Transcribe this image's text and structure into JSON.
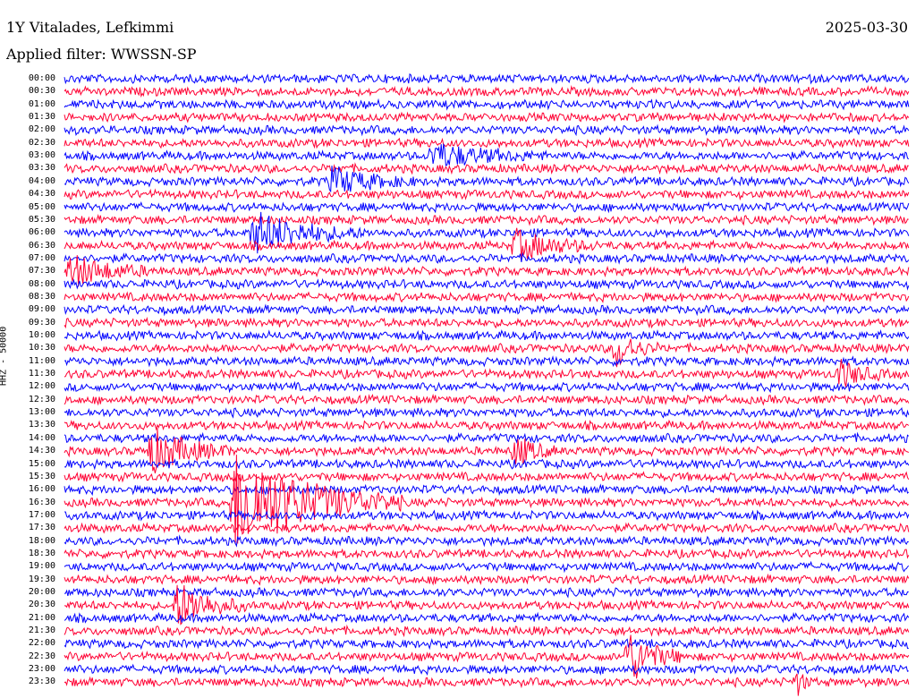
{
  "header": {
    "station": "1Y Vitalades, Lefkimmi",
    "date": "2025-03-30",
    "filter": "Applied filter: WWSSN-SP"
  },
  "channel_label": "HHZ - 50000",
  "colors": {
    "blue": "#0000ff",
    "red": "#ff0033"
  },
  "chart_data": {
    "type": "line",
    "title": "",
    "rows": [
      "00:00",
      "00:30",
      "01:00",
      "01:30",
      "02:00",
      "02:30",
      "03:00",
      "03:30",
      "04:00",
      "04:30",
      "05:00",
      "05:30",
      "06:00",
      "06:30",
      "07:00",
      "07:30",
      "08:00",
      "08:30",
      "09:00",
      "09:30",
      "10:00",
      "10:30",
      "11:00",
      "11:30",
      "12:00",
      "12:30",
      "13:00",
      "13:30",
      "14:00",
      "14:30",
      "15:00",
      "15:30",
      "16:00",
      "16:30",
      "17:00",
      "17:30",
      "18:00",
      "18:30",
      "19:00",
      "19:30",
      "20:00",
      "20:30",
      "21:00",
      "21:30",
      "22:00",
      "22:30",
      "23:00",
      "23:30"
    ],
    "row_minutes": 30,
    "row_colors": [
      "blue",
      "red"
    ],
    "events": [
      {
        "row_start": 33,
        "minute": 6.0,
        "duration_min": 6.0,
        "amplitude": 5.0
      },
      {
        "row_start": 12,
        "minute": 6.7,
        "duration_min": 4.0,
        "amplitude": 2.0
      },
      {
        "row_start": 29,
        "minute": 3.0,
        "duration_min": 3.0,
        "amplitude": 2.2
      },
      {
        "row_start": 41,
        "minute": 4.0,
        "duration_min": 2.5,
        "amplitude": 2.2
      },
      {
        "row_start": 45,
        "minute": 20.0,
        "duration_min": 2.0,
        "amplitude": 2.6
      },
      {
        "row_start": 21,
        "minute": 19.6,
        "duration_min": 1.5,
        "amplitude": 1.8
      },
      {
        "row_start": 29,
        "minute": 16.0,
        "duration_min": 1.5,
        "amplitude": 1.5
      },
      {
        "row_start": 6,
        "minute": 13.0,
        "duration_min": 4.0,
        "amplitude": 1.2
      },
      {
        "row_start": 8,
        "minute": 9.5,
        "duration_min": 3.0,
        "amplitude": 1.3
      },
      {
        "row_start": 13,
        "minute": 16.0,
        "duration_min": 3.0,
        "amplitude": 1.4
      },
      {
        "row_start": 15,
        "minute": 0.2,
        "duration_min": 3.0,
        "amplitude": 1.5
      },
      {
        "row_start": 23,
        "minute": 27.5,
        "duration_min": 1.8,
        "amplitude": 1.3
      },
      {
        "row_start": 47,
        "minute": 26.0,
        "duration_min": 0.6,
        "amplitude": 1.3
      }
    ]
  }
}
